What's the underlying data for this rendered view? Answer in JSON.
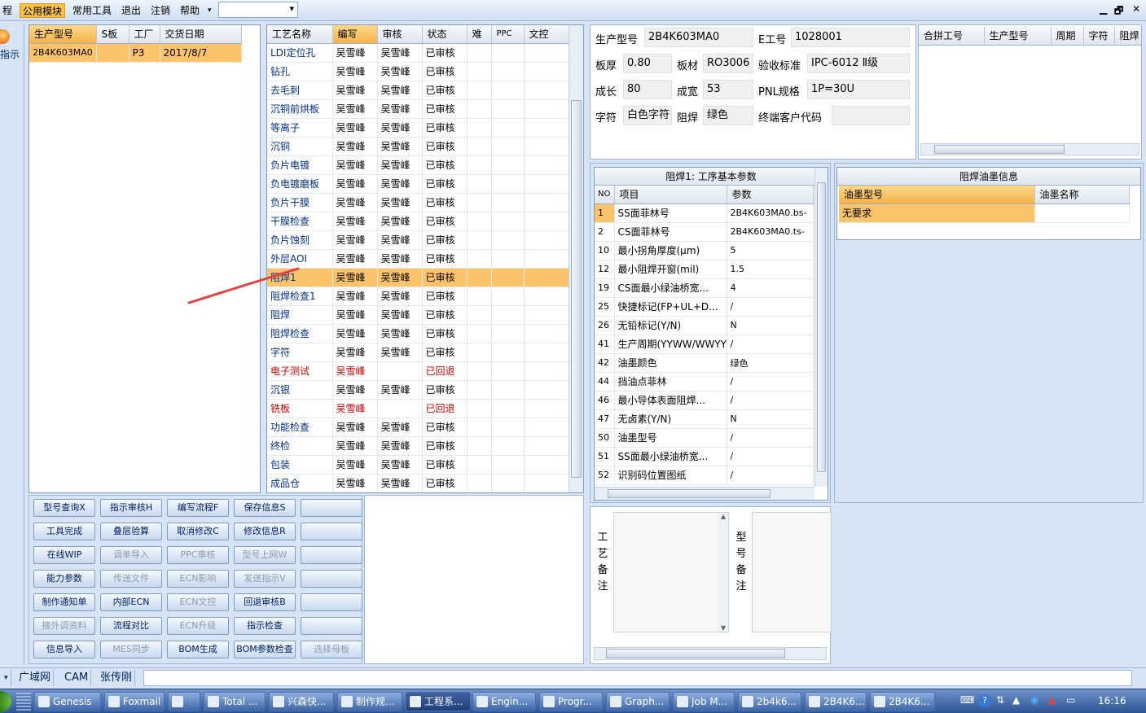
{
  "menu": {
    "items": [
      "程",
      "公用模块",
      "常用工具",
      "退出",
      "注销",
      "帮助"
    ],
    "combo_value": ""
  },
  "window_controls": {
    "minimize": "▁",
    "restore": "🗗",
    "close": "✕"
  },
  "leftstrip": {
    "label": "指示"
  },
  "orders": {
    "headers": [
      "生产型号",
      "S板",
      "工厂",
      "交货日期"
    ],
    "rows": [
      [
        "2B4K603MA0",
        "",
        "P3",
        "2017/8/7"
      ]
    ]
  },
  "process": {
    "headers": [
      "工艺名称",
      "编写",
      "审核",
      "状态",
      "难",
      "PPC",
      "文控"
    ],
    "rows": [
      [
        "LDI定位孔",
        "吴雪峰",
        "吴雪峰",
        "已审核"
      ],
      [
        "钻孔",
        "吴雪峰",
        "吴雪峰",
        "已审核"
      ],
      [
        "去毛刺",
        "吴雪峰",
        "吴雪峰",
        "已审核"
      ],
      [
        "沉铜前烘板",
        "吴雪峰",
        "吴雪峰",
        "已审核"
      ],
      [
        "等离子",
        "吴雪峰",
        "吴雪峰",
        "已审核"
      ],
      [
        "沉铜",
        "吴雪峰",
        "吴雪峰",
        "已审核"
      ],
      [
        "负片电镀",
        "吴雪峰",
        "吴雪峰",
        "已审核"
      ],
      [
        "负电镀磨板",
        "吴雪峰",
        "吴雪峰",
        "已审核"
      ],
      [
        "负片干膜",
        "吴雪峰",
        "吴雪峰",
        "已审核"
      ],
      [
        "干膜检查",
        "吴雪峰",
        "吴雪峰",
        "已审核"
      ],
      [
        "负片蚀刻",
        "吴雪峰",
        "吴雪峰",
        "已审核"
      ],
      [
        "外层AOI",
        "吴雪峰",
        "吴雪峰",
        "已审核"
      ],
      [
        "阻焊1",
        "吴雪峰",
        "吴雪峰",
        "已审核"
      ],
      [
        "阻焊检查1",
        "吴雪峰",
        "吴雪峰",
        "已审核"
      ],
      [
        "阻焊",
        "吴雪峰",
        "吴雪峰",
        "已审核"
      ],
      [
        "阻焊检查",
        "吴雪峰",
        "吴雪峰",
        "已审核"
      ],
      [
        "字符",
        "吴雪峰",
        "吴雪峰",
        "已审核"
      ],
      [
        "电子测试",
        "吴雪峰",
        "",
        "已回退"
      ],
      [
        "沉银",
        "吴雪峰",
        "吴雪峰",
        "已审核"
      ],
      [
        "铣板",
        "吴雪峰",
        "",
        "已回退"
      ],
      [
        "功能检查",
        "吴雪峰",
        "吴雪峰",
        "已审核"
      ],
      [
        "终检",
        "吴雪峰",
        "吴雪峰",
        "已审核"
      ],
      [
        "包装",
        "吴雪峰",
        "吴雪峰",
        "已审核"
      ],
      [
        "成品仓",
        "吴雪峰",
        "吴雪峰",
        "已审核"
      ]
    ]
  },
  "buttons": [
    [
      "型号查询X",
      "指示审核H",
      "编写流程F",
      "保存信息S",
      ""
    ],
    [
      "工具完成",
      "叠层验算",
      "取消修改C",
      "修改信息R",
      ""
    ],
    [
      "在线WIP",
      "调单导入",
      "PPC审核",
      "型号上网W",
      ""
    ],
    [
      "能力参数",
      "传送文件",
      "ECN影响",
      "发送指示V",
      ""
    ],
    [
      "制作通知单",
      "内部ECN",
      "ECN文控",
      "回退审核B",
      ""
    ],
    [
      "接外调资料",
      "流程对比",
      "ECN升级",
      "指示检查",
      ""
    ],
    [
      "信息导入",
      "MES同步",
      "BOM生成",
      "BOM参数检查",
      "选择母板"
    ]
  ],
  "info": {
    "model_label": "生产型号",
    "model": "2B4K603MA0",
    "eno_label": "E工号",
    "eno": "1028001",
    "thick_label": "板厚",
    "thick": "0.80",
    "mat_label": "板材",
    "mat": "RO3006",
    "std_label": "验收标准",
    "std": "IPC-6012 Ⅱ级",
    "len_label": "成长",
    "len": "80",
    "wid_label": "成宽",
    "wid": "53",
    "pnl_label": "PNL规格",
    "pnl": "1P=30U",
    "char_label": "字符",
    "char": "白色字符",
    "mask_label": "阻焊",
    "mask": "绿色",
    "cust_label": "终端客户代码",
    "cust": ""
  },
  "merge": {
    "headers": [
      "合拼工号",
      "生产型号",
      "周期",
      "字符",
      "阻焊"
    ]
  },
  "params": {
    "title": "阻焊1: 工序基本参数",
    "headers": [
      "NO",
      "项目",
      "参数"
    ],
    "rows": [
      [
        "1",
        "SS面菲林号",
        "2B4K603MA0.bs-"
      ],
      [
        "2",
        "CS面菲林号",
        "2B4K603MA0.ts-"
      ],
      [
        "10",
        "最小拐角厚度(μm)",
        "5"
      ],
      [
        "12",
        "最小阻焊开窗(mil)",
        "1.5"
      ],
      [
        "19",
        "CS面最小绿油桥宽...",
        "4"
      ],
      [
        "25",
        "快捷标记(FP+UL+D...",
        "/"
      ],
      [
        "26",
        "无铅标记(Y/N)",
        "N"
      ],
      [
        "41",
        "生产周期(YYWW/WWYY)",
        "/"
      ],
      [
        "42",
        "油墨颜色",
        "绿色"
      ],
      [
        "44",
        "挡油点菲林",
        "/"
      ],
      [
        "46",
        "最小导体表面阻焊...",
        "/"
      ],
      [
        "47",
        "无卤素(Y/N)",
        "N"
      ],
      [
        "50",
        "油墨型号",
        "/"
      ],
      [
        "51",
        "SS面最小绿油桥宽...",
        "/"
      ],
      [
        "52",
        "识别码位置图纸",
        "/"
      ]
    ]
  },
  "ink": {
    "title": "阻焊油墨信息",
    "headers": [
      "油墨型号",
      "油墨名称"
    ],
    "rows": [
      [
        "无要求",
        ""
      ]
    ]
  },
  "remarks": {
    "process_label": "工艺备注",
    "model_label": "型号备注"
  },
  "status_tabs": [
    "广域网",
    "CAM",
    "张传刚"
  ],
  "taskbar": {
    "items": [
      "Genesis",
      "Foxmail",
      "",
      "Total ...",
      "兴森快...",
      "制作规...",
      "工程系...",
      "Engin...",
      "Progr...",
      "Graph...",
      "Job M...",
      "2b4k6...",
      "2B4K6...",
      "2B4K6..."
    ],
    "clock": "16:16"
  }
}
